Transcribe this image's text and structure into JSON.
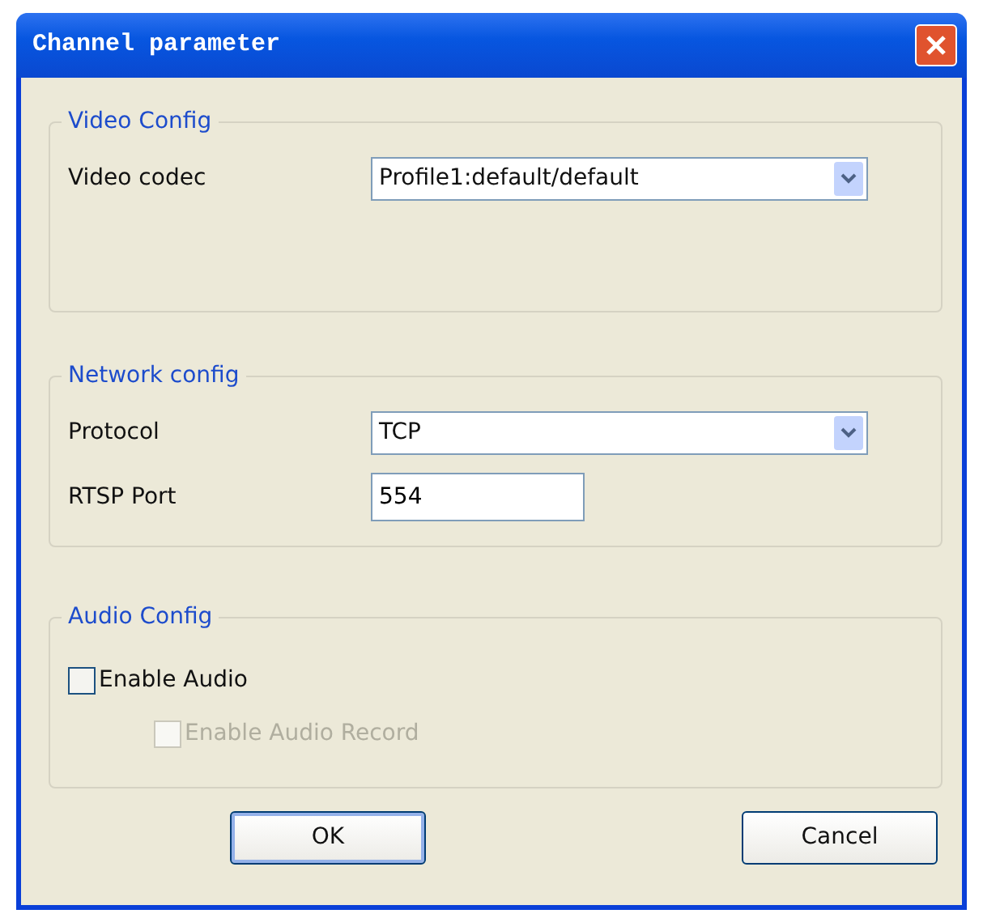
{
  "window": {
    "title": "Channel parameter"
  },
  "groups": [
    {
      "title": "Video Config",
      "fields": [
        {
          "kind": "select",
          "label": "Video codec",
          "value": "Profile1:default/default"
        }
      ]
    },
    {
      "title": "Network config",
      "fields": [
        {
          "kind": "select",
          "label": "Protocol",
          "value": "TCP"
        },
        {
          "kind": "text",
          "label": "RTSP Port",
          "value": "554"
        }
      ]
    },
    {
      "title": "Audio Config",
      "fields": [
        {
          "kind": "checkbox",
          "label": "Enable Audio",
          "checked": false,
          "disabled": false
        },
        {
          "kind": "checkbox",
          "label": "Enable Audio Record",
          "checked": false,
          "disabled": true
        }
      ]
    }
  ],
  "buttons": [
    {
      "label": "OK",
      "default": true
    },
    {
      "label": "Cancel",
      "default": false
    }
  ]
}
